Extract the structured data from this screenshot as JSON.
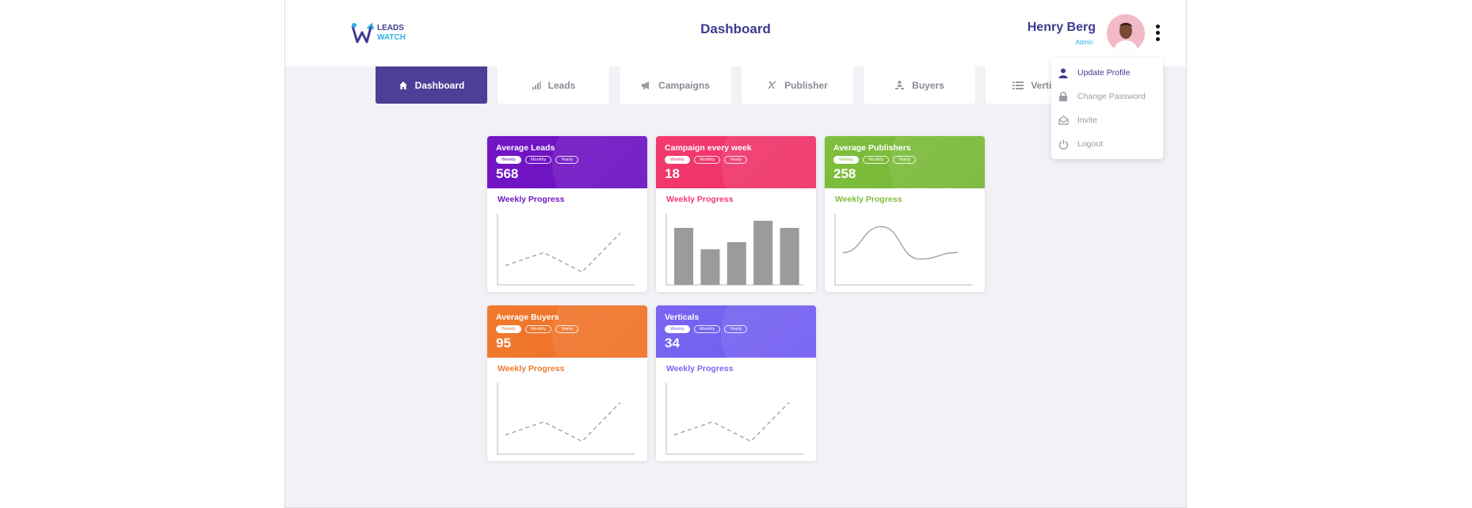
{
  "header": {
    "logo": {
      "line1": "LEADS",
      "line2": "WATCH"
    },
    "title": "Dashboard",
    "user": {
      "name": "Henry Berg",
      "role": "Admin"
    }
  },
  "tabs": [
    {
      "label": "Dashboard",
      "icon": "home-icon",
      "active": true
    },
    {
      "label": "Leads",
      "icon": "bar-chart-icon",
      "active": false
    },
    {
      "label": "Campaigns",
      "icon": "megaphone-icon",
      "active": false
    },
    {
      "label": "Publisher",
      "icon": "publisher-icon",
      "active": false
    },
    {
      "label": "Buyers",
      "icon": "buyers-icon",
      "active": false
    },
    {
      "label": "Verticals",
      "icon": "list-icon",
      "active": false
    }
  ],
  "dropdown": [
    {
      "label": "Update Profile",
      "icon": "user-icon"
    },
    {
      "label": "Change Password",
      "icon": "lock-icon"
    },
    {
      "label": "Invite",
      "icon": "envelope-icon"
    },
    {
      "label": "Logout",
      "icon": "power-icon"
    }
  ],
  "periods": [
    "Weekly",
    "Monthly",
    "Yearly"
  ],
  "cards": [
    {
      "title": "Average Leads",
      "value": "568",
      "subtitle": "Weekly Progress",
      "color": "#7316c4",
      "gradient": "#6a11c2",
      "chart": "dashed"
    },
    {
      "title": "Campaign every week",
      "value": "18",
      "subtitle": "Weekly Progress",
      "color": "#f23a6e",
      "gradient": "#ee2f68",
      "chart": "bars"
    },
    {
      "title": "Average Publishers",
      "value": "258",
      "subtitle": "Weekly Progress",
      "color": "#7fbe3e",
      "gradient": "#75b735",
      "chart": "curve"
    },
    {
      "title": "Average Buyers",
      "value": "95",
      "subtitle": "Weekly Progress",
      "color": "#f07a2e",
      "gradient": "#ee7026",
      "chart": "dashed"
    },
    {
      "title": "Verticals",
      "value": "34",
      "subtitle": "Weekly Progress",
      "color": "#7a66f2",
      "gradient": "#705cf0",
      "chart": "dashed"
    }
  ],
  "chart_data": [
    {
      "type": "line",
      "values": [
        2,
        4,
        1,
        7
      ]
    },
    {
      "type": "bar",
      "values": [
        8,
        5,
        6,
        9,
        8
      ]
    },
    {
      "type": "line",
      "values": [
        4,
        8,
        3,
        4
      ]
    },
    {
      "type": "line",
      "values": [
        2,
        4,
        1,
        7
      ]
    },
    {
      "type": "line",
      "values": [
        2,
        4,
        1,
        7
      ]
    }
  ]
}
